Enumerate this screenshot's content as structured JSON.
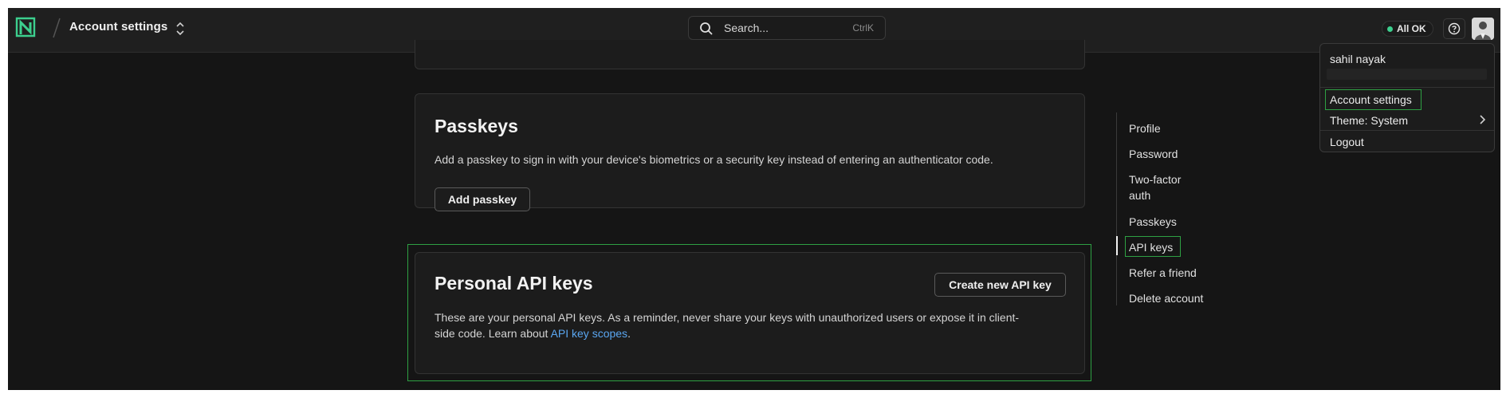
{
  "header": {
    "page_title": "Account settings",
    "search_placeholder": "Search...",
    "search_shortcut": "CtrlK",
    "status_label": "All OK",
    "status_color": "#3ccf8e"
  },
  "sections": {
    "passkeys": {
      "title": "Passkeys",
      "description": "Add a passkey to sign in with your device's biometrics or a security key instead of entering an authenticator code.",
      "button_label": "Add passkey"
    },
    "api_keys": {
      "title": "Personal API keys",
      "button_label": "Create new API key",
      "description_part1": "These are your personal API keys. As a reminder, never share your keys with unauthorized users or expose it in client-",
      "description_part2": "side code. Learn about ",
      "link_text": "API key scopes",
      "description_end": "."
    }
  },
  "toc": {
    "items": [
      "Profile",
      "Password",
      "Two-factor auth",
      "Passkeys",
      "API keys",
      "Refer a friend",
      "Delete account"
    ],
    "active": "API keys"
  },
  "user_menu": {
    "user_name": "sahil nayak",
    "items": {
      "account_settings": "Account settings",
      "theme": "Theme: System",
      "logout": "Logout"
    }
  },
  "colors": {
    "accent_green": "#2ea043",
    "link_blue": "#5aa6f0",
    "logo_green": "#3ccf8e"
  },
  "icons": {
    "logo": "logo-icon",
    "switcher": "chevron-up-down-icon",
    "search": "search-icon",
    "help": "help-circle-icon",
    "theme_submenu": "chevron-right-icon"
  }
}
